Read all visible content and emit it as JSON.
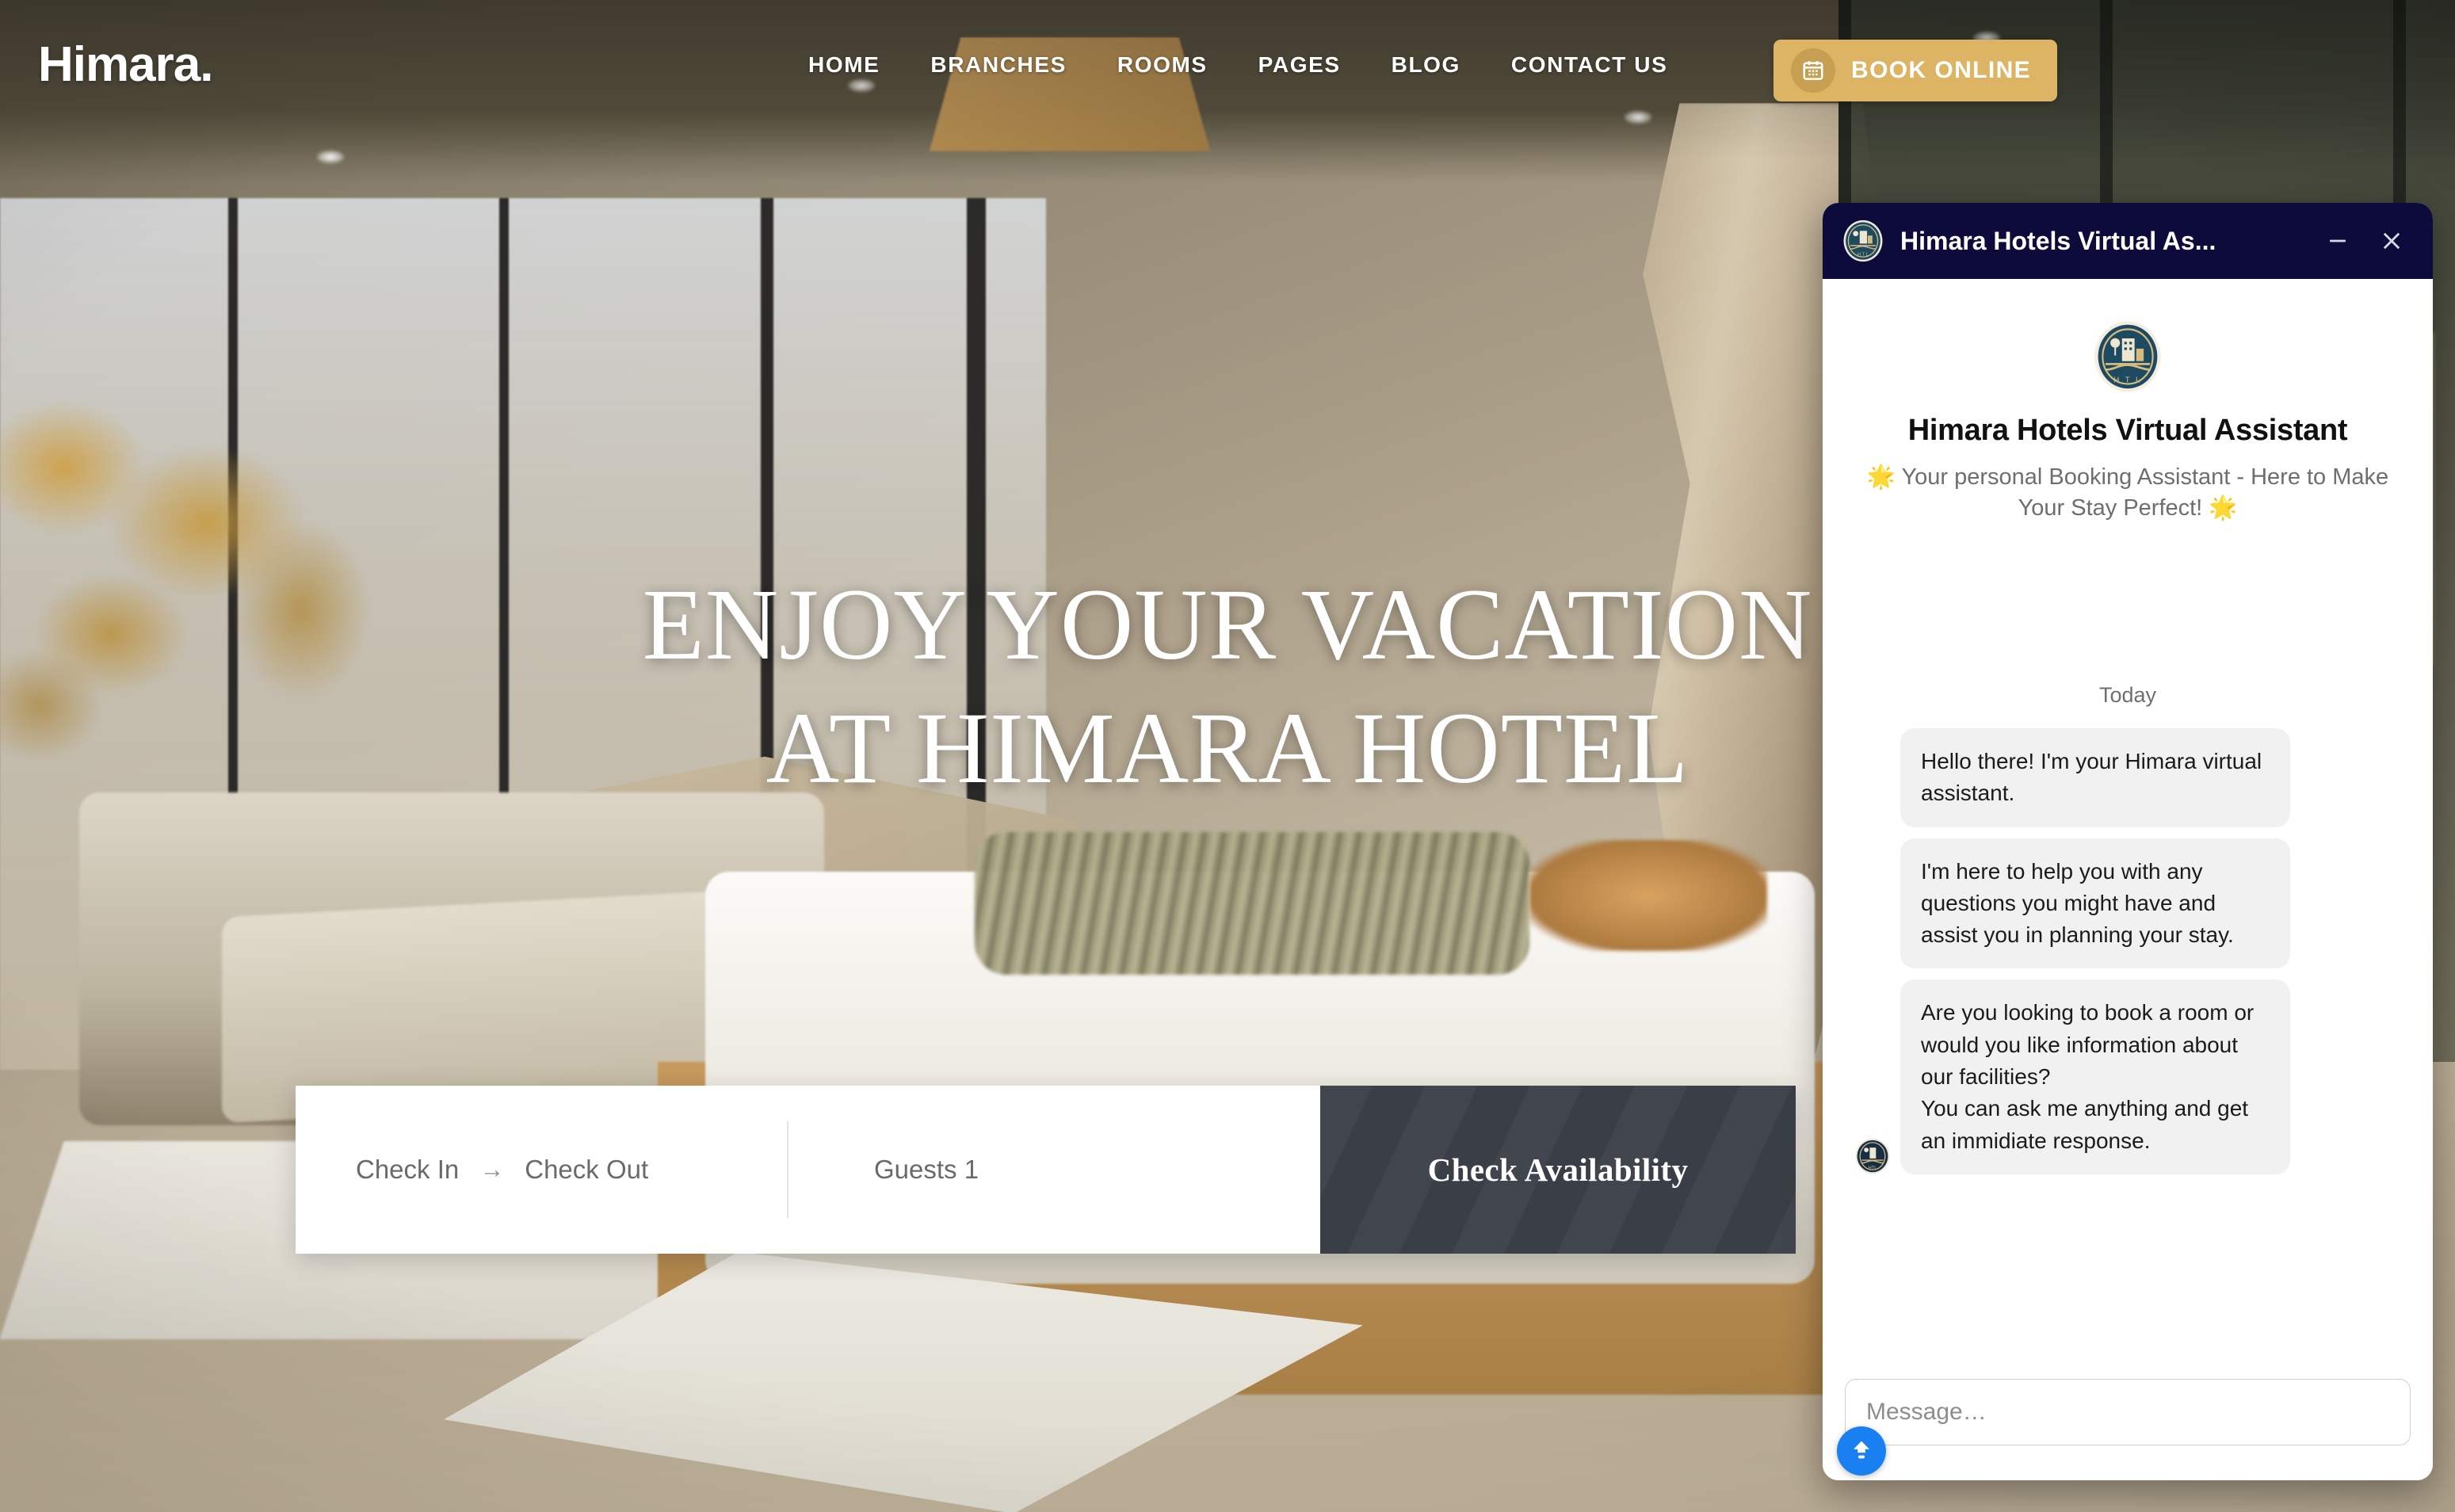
{
  "site": {
    "logo": "Himara.",
    "nav": [
      {
        "label": "HOME"
      },
      {
        "label": "BRANCHES"
      },
      {
        "label": "ROOMS"
      },
      {
        "label": "PAGES"
      },
      {
        "label": "BLOG"
      },
      {
        "label": "CONTACT US"
      }
    ],
    "book_button": {
      "label": "BOOK ONLINE",
      "icon": "calendar-icon",
      "color": "#dcb464"
    }
  },
  "hero": {
    "title_line1": "ENJOY YOUR VACATION",
    "title_line2": "AT HIMARA HOTEL"
  },
  "booking": {
    "check_in": "Check In",
    "arrow": "→",
    "check_out": "Check Out",
    "guests": "Guests 1",
    "submit": "Check Availability",
    "submit_color": "#3c4048"
  },
  "chat": {
    "header": {
      "title": "Himara Hotels Virtual As...",
      "minimize": "–",
      "close": "✕",
      "background": "#0d0a3c"
    },
    "welcome": {
      "title": "Himara Hotels Virtual Assistant",
      "subtitle": "🌟 Your personal Booking Assistant - Here to Make Your Stay Perfect! 🌟"
    },
    "day_divider": "Today",
    "messages": [
      {
        "sender": "bot",
        "text": "Hello there! I'm your Himara virtual assistant.",
        "show_avatar": false
      },
      {
        "sender": "bot",
        "text": "I'm here to help you with any questions you might have and assist you in planning your stay.",
        "show_avatar": false
      },
      {
        "sender": "bot",
        "text": "Are you looking to book a room or would you like information about our facilities?\nYou can ask me anything and get an immidiate response.",
        "show_avatar": true
      }
    ],
    "input": {
      "value": "",
      "placeholder": "Message…"
    },
    "upload_button": {
      "icon": "upload-icon",
      "color": "#1a7ff0"
    }
  }
}
